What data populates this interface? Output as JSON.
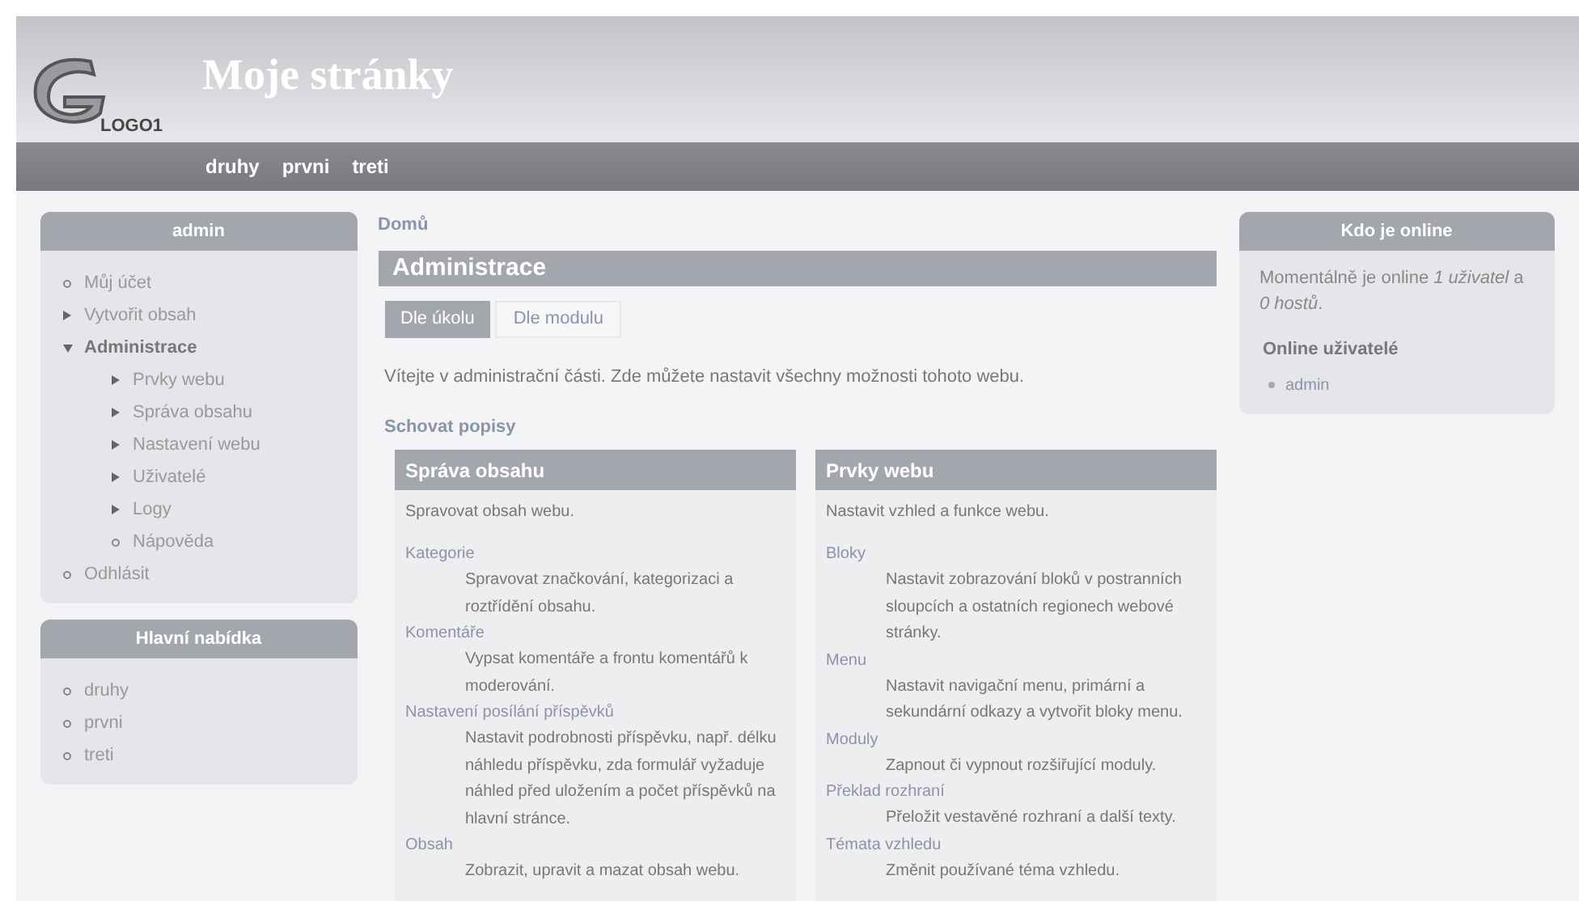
{
  "header": {
    "logo_text": "LOGO1",
    "site_name": "Moje stránky"
  },
  "primary_links": [
    "druhy",
    "prvni",
    "treti"
  ],
  "sidebar_left": [
    {
      "title": "admin",
      "items": [
        {
          "label": "Můj účet",
          "kind": "leaf"
        },
        {
          "label": "Vytvořit obsah",
          "kind": "collapsed"
        },
        {
          "label": "Administrace",
          "kind": "expanded",
          "children": [
            {
              "label": "Prvky webu",
              "kind": "collapsed"
            },
            {
              "label": "Správa obsahu",
              "kind": "collapsed"
            },
            {
              "label": "Nastavení webu",
              "kind": "collapsed"
            },
            {
              "label": "Uživatelé",
              "kind": "collapsed"
            },
            {
              "label": "Logy",
              "kind": "collapsed"
            },
            {
              "label": "Nápověda",
              "kind": "leaf"
            }
          ]
        },
        {
          "label": "Odhlásit",
          "kind": "leaf"
        }
      ]
    },
    {
      "title": "Hlavní nabídka",
      "items": [
        {
          "label": "druhy",
          "kind": "leaf"
        },
        {
          "label": "prvni",
          "kind": "leaf"
        },
        {
          "label": "treti",
          "kind": "leaf"
        }
      ]
    }
  ],
  "breadcrumb": "Domů",
  "page_title": "Administrace",
  "tabs": [
    {
      "label": "Dle úkolu",
      "selected": true
    },
    {
      "label": "Dle modulu",
      "selected": false
    }
  ],
  "intro": "Vítejte v administrační části. Zde můžete nastavit všechny možnosti tohoto webu.",
  "toggle_link": "Schovat popisy",
  "panels": [
    {
      "title": "Správa obsahu",
      "description": "Spravovat obsah webu.",
      "entries": [
        {
          "link": "Kategorie",
          "description": "Spravovat značkování, kategorizaci a roztřídění obsahu."
        },
        {
          "link": "Komentáře",
          "description": "Vypsat komentáře a frontu komentářů k moderování."
        },
        {
          "link": "Nastavení posílání příspěvků",
          "description": "Nastavit podrobnosti příspěvku, např. délku náhledu příspěvku, zda formulář vyžaduje náhled před uložením a počet příspěvků na hlavní stránce."
        },
        {
          "link": "Obsah",
          "description": "Zobrazit, upravit a mazat obsah webu."
        }
      ]
    },
    {
      "title": "Prvky webu",
      "description": "Nastavit vzhled a funkce webu.",
      "entries": [
        {
          "link": "Bloky",
          "description": "Nastavit zobrazování bloků v postranních sloupcích a ostatních regionech webové stránky."
        },
        {
          "link": "Menu",
          "description": "Nastavit navigační menu, primární a sekundární odkazy a vytvořit bloky menu."
        },
        {
          "link": "Moduly",
          "description": "Zapnout či vypnout rozšiřující moduly."
        },
        {
          "link": "Překlad rozhraní",
          "description": "Přeložit vestavěné rozhraní a další texty."
        },
        {
          "link": "Témata vzhledu",
          "description": "Změnit používané téma vzhledu."
        }
      ]
    }
  ],
  "sidebar_right": {
    "title": "Kdo je online",
    "text": "Momentálně je online *1 uživatel* a *0 hostů*.",
    "subtitle": "Online uživatelé",
    "users": [
      "admin"
    ]
  }
}
